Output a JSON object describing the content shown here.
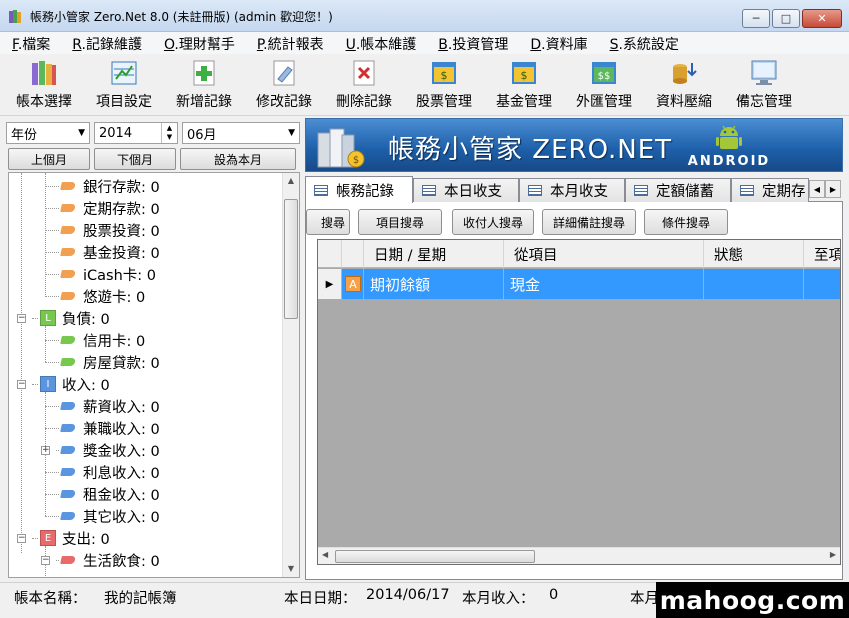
{
  "window": {
    "title": "帳務小管家 Zero.Net 8.0 (未註冊版) (admin 歡迎您！)",
    "min_glyph": "─",
    "max_glyph": "□",
    "close_glyph": "✕"
  },
  "menu": [
    {
      "key": "F",
      "label": ".檔案"
    },
    {
      "key": "R",
      "label": ".記錄維護"
    },
    {
      "key": "O",
      "label": ".理財幫手"
    },
    {
      "key": "P",
      "label": ".統計報表"
    },
    {
      "key": "U",
      "label": ".帳本維護"
    },
    {
      "key": "B",
      "label": ".投資管理"
    },
    {
      "key": "D",
      "label": ".資料庫"
    },
    {
      "key": "S",
      "label": ".系統設定"
    }
  ],
  "toolbar": [
    {
      "label": "帳本選擇",
      "icon": "books-icon"
    },
    {
      "label": "項目設定",
      "icon": "ledger-settings-icon"
    },
    {
      "label": "新增記錄",
      "icon": "add-record-icon"
    },
    {
      "label": "修改記錄",
      "icon": "edit-record-icon"
    },
    {
      "label": "刪除記錄",
      "icon": "delete-record-icon"
    },
    {
      "label": "股票管理",
      "icon": "stock-icon"
    },
    {
      "label": "基金管理",
      "icon": "fund-icon"
    },
    {
      "label": "外匯管理",
      "icon": "forex-icon"
    },
    {
      "label": "資料壓縮",
      "icon": "compress-icon"
    },
    {
      "label": "備忘管理",
      "icon": "memo-icon"
    }
  ],
  "filters": {
    "period_select": "年份",
    "year_value": "2014",
    "month_select": "06月",
    "prev_month": "上個月",
    "next_month": "下個月",
    "set_current_month": "設為本月"
  },
  "tree": [
    {
      "label": "銀行存款: 0",
      "level": 2,
      "kind": "leaf",
      "color": "#f0a050"
    },
    {
      "label": "定期存款: 0",
      "level": 2,
      "kind": "leaf",
      "color": "#f0a050"
    },
    {
      "label": "股票投資: 0",
      "level": 2,
      "kind": "leaf",
      "color": "#f0a050"
    },
    {
      "label": "基金投資: 0",
      "level": 2,
      "kind": "leaf",
      "color": "#f0a050"
    },
    {
      "label": "iCash卡: 0",
      "level": 2,
      "kind": "leaf",
      "color": "#f0a050"
    },
    {
      "label": "悠遊卡: 0",
      "level": 2,
      "kind": "leaf",
      "color": "#f0a050"
    },
    {
      "label": "負債: 0",
      "level": 1,
      "kind": "cat",
      "badge": "L",
      "color": "#78c850"
    },
    {
      "label": "信用卡: 0",
      "level": 2,
      "kind": "leaf",
      "color": "#78c850"
    },
    {
      "label": "房屋貸款: 0",
      "level": 2,
      "kind": "leaf",
      "color": "#78c850"
    },
    {
      "label": "收入: 0",
      "level": 1,
      "kind": "cat",
      "badge": "I",
      "color": "#5a96e0"
    },
    {
      "label": "薪資收入: 0",
      "level": 2,
      "kind": "leaf",
      "color": "#5a96e0"
    },
    {
      "label": "兼職收入: 0",
      "level": 2,
      "kind": "leaf",
      "color": "#5a96e0"
    },
    {
      "label": "獎金收入: 0",
      "level": 2,
      "kind": "leaf",
      "color": "#5a96e0",
      "expandable": true
    },
    {
      "label": "利息收入: 0",
      "level": 2,
      "kind": "leaf",
      "color": "#5a96e0"
    },
    {
      "label": "租金收入: 0",
      "level": 2,
      "kind": "leaf",
      "color": "#5a96e0"
    },
    {
      "label": "其它收入: 0",
      "level": 2,
      "kind": "leaf",
      "color": "#5a96e0"
    },
    {
      "label": "支出: 0",
      "level": 1,
      "kind": "cat",
      "badge": "E",
      "color": "#e86a6a"
    },
    {
      "label": "生活飲食: 0",
      "level": 2,
      "kind": "leaf",
      "color": "#e86a6a",
      "expanded": true
    }
  ],
  "banner": {
    "title": "帳務小管家 ZERO.NET",
    "android_label": "ANDROID",
    "colors": {
      "bg": "#1d5ea8",
      "android": "#a4c639"
    }
  },
  "tabs": [
    {
      "label": "帳務記錄",
      "active": true
    },
    {
      "label": "本日收支",
      "active": false
    },
    {
      "label": "本月收支",
      "active": false
    },
    {
      "label": "定額儲蓄",
      "active": false
    },
    {
      "label": "定期存",
      "active": false
    }
  ],
  "search_buttons": [
    "搜尋",
    "項目搜尋",
    "收付人搜尋",
    "詳細備註搜尋",
    "條件搜尋"
  ],
  "grid": {
    "columns": [
      "日期 / 星期",
      "從項目",
      "狀態",
      "至項"
    ],
    "rows": [
      {
        "type_badge": "A",
        "date": "期初餘額",
        "from_item": "現金",
        "status": "",
        "to_item": ""
      }
    ],
    "selection_color": "#3399ff"
  },
  "status": {
    "ledger_label": "帳本名稱：",
    "ledger_name": "我的記帳簿",
    "today_label": "本日日期：",
    "today_value": "2014/06/17",
    "month_income_label": "本月收入：",
    "month_income_value": "0",
    "month_expense_label": "本月"
  },
  "watermark": "mahoog.com"
}
